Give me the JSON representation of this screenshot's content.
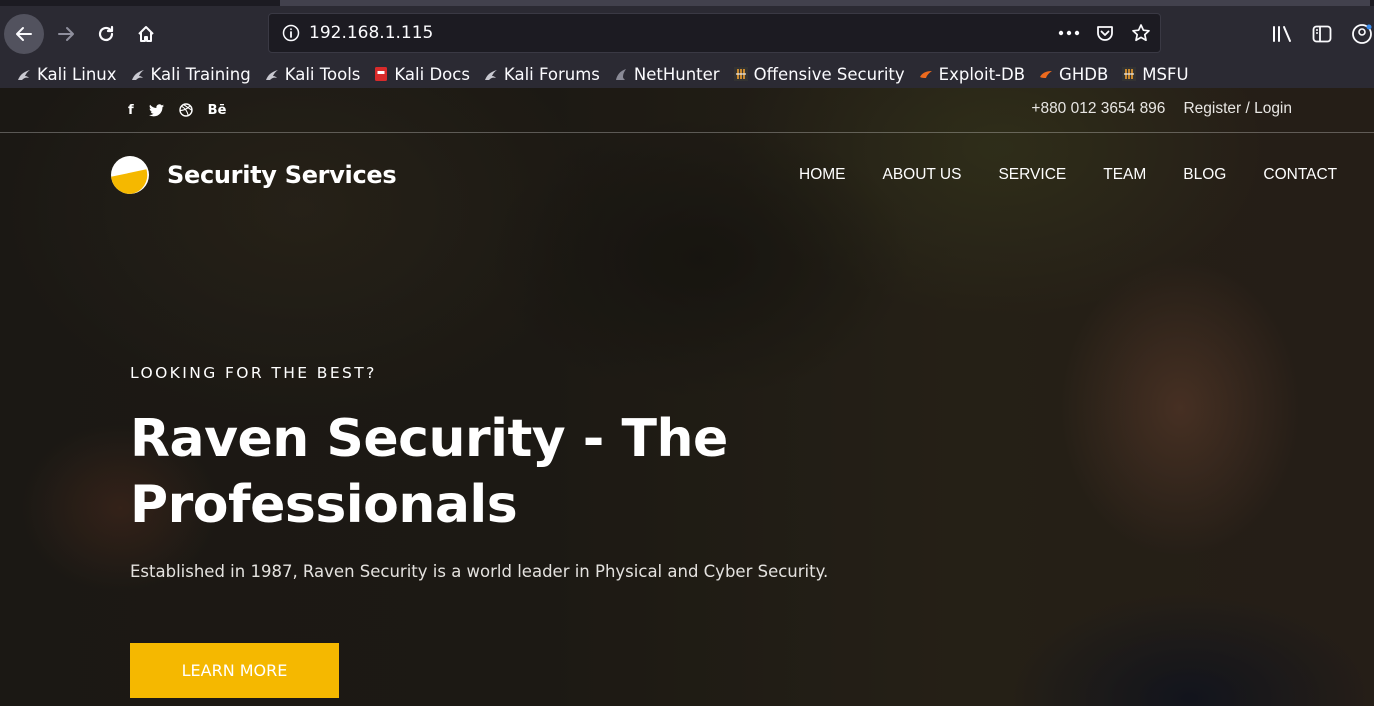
{
  "browser": {
    "url": "192.168.1.115",
    "bookmarks": [
      {
        "label": "Kali Linux",
        "icon": "kali-dragon-icon"
      },
      {
        "label": "Kali Training",
        "icon": "kali-dragon-icon"
      },
      {
        "label": "Kali Tools",
        "icon": "kali-dragon-icon"
      },
      {
        "label": "Kali Docs",
        "icon": "kali-docs-icon"
      },
      {
        "label": "Kali Forums",
        "icon": "kali-dragon-icon"
      },
      {
        "label": "NetHunter",
        "icon": "nethunter-icon"
      },
      {
        "label": "Offensive Security",
        "icon": "offsec-icon"
      },
      {
        "label": "Exploit-DB",
        "icon": "exploit-db-icon"
      },
      {
        "label": "GHDB",
        "icon": "ghdb-icon"
      },
      {
        "label": "MSFU",
        "icon": "offsec-icon"
      }
    ]
  },
  "site": {
    "topbar": {
      "socials": [
        "f",
        "Bē"
      ],
      "phone": "+880 012 3654 896",
      "login": "Register / Login"
    },
    "brand": "Security Services",
    "nav": [
      "HOME",
      "ABOUT US",
      "SERVICE",
      "TEAM",
      "BLOG",
      "CONTACT"
    ],
    "hero": {
      "eyebrow": "LOOKING FOR THE BEST?",
      "headline": "Raven Security - The Professionals",
      "lead": "Established in 1987, Raven Security is a world leader in Physical and Cyber Security.",
      "cta": "LEARN MORE"
    },
    "colors": {
      "accent": "#f5b800"
    }
  }
}
